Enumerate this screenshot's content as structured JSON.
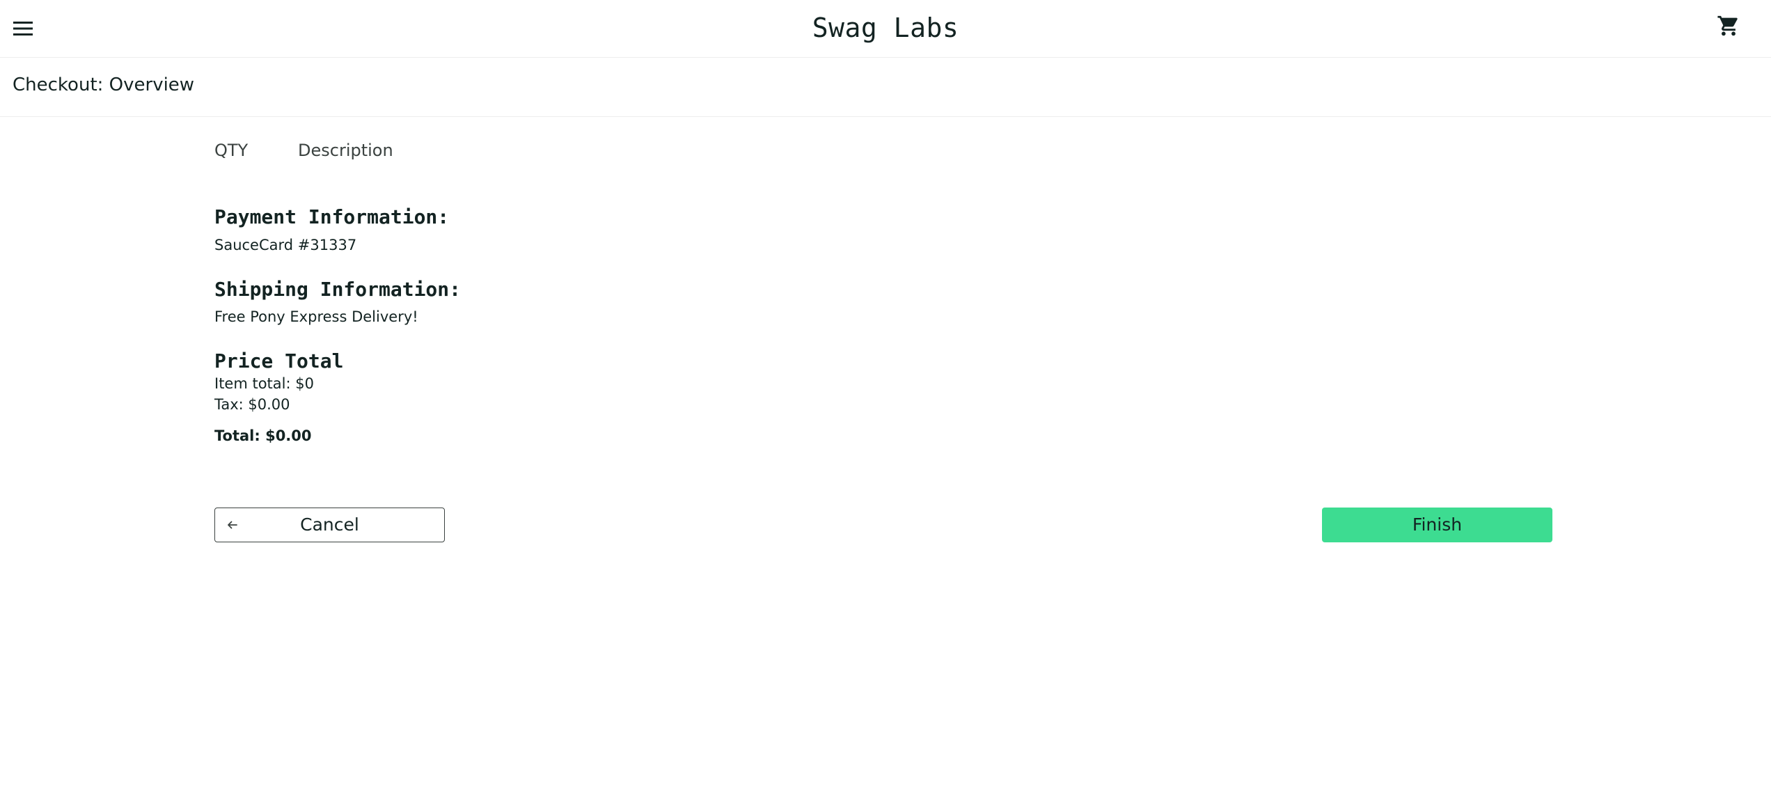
{
  "header": {
    "app_title": "Swag Labs",
    "menu_icon": "hamburger-menu-icon",
    "cart_icon": "shopping-cart-icon"
  },
  "subheader": {
    "title": "Checkout: Overview"
  },
  "cart_list": {
    "qty_label": "QTY",
    "description_label": "Description"
  },
  "summary": {
    "payment_label": "Payment Information:",
    "payment_value": "SauceCard #31337",
    "shipping_label": "Shipping Information:",
    "shipping_value": "Free Pony Express Delivery!",
    "price_label": "Price Total",
    "item_total": "Item total: $0",
    "tax": "Tax: $0.00",
    "total": "Total: $0.00"
  },
  "actions": {
    "cancel_label": "Cancel",
    "cancel_icon": "arrow-left-icon",
    "finish_label": "Finish"
  },
  "colors": {
    "accent": "#3ddc91",
    "text": "#132322",
    "border": "#ededed"
  }
}
